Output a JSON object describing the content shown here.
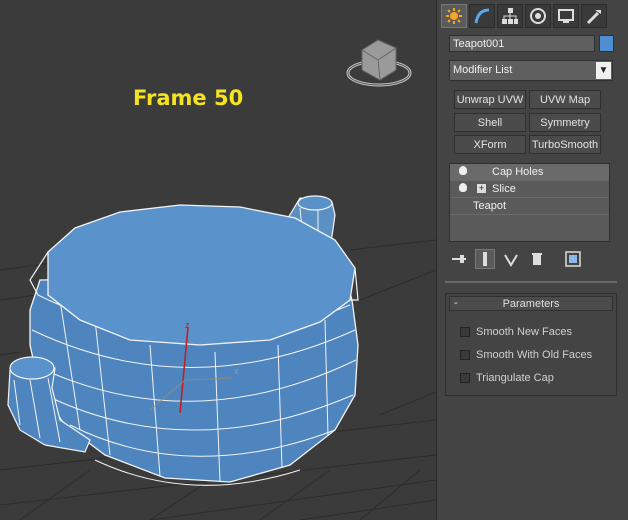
{
  "viewport": {
    "frame_label": "Frame 50"
  },
  "command_panel": {
    "tabs": [
      "create-icon",
      "modify-icon",
      "hierarchy-icon",
      "motion-icon",
      "display-icon",
      "utilities-icon"
    ],
    "object_name": "Teapot001",
    "object_color": "#4d8fd0",
    "modifier_list": "Modifier List",
    "modifier_buttons": [
      "Unwrap UVW",
      "UVW Map",
      "Shell",
      "Symmetry",
      "XForm",
      "TurboSmooth"
    ],
    "stack": [
      {
        "label": "Cap Holes"
      },
      {
        "label": "Slice"
      },
      {
        "label": "Teapot"
      }
    ],
    "stack_tools": [
      "pin-stack-icon",
      "show-end-result-icon",
      "make-unique-icon",
      "remove-modifier-icon",
      "configure-sets-icon"
    ]
  },
  "parameters": {
    "header": "Parameters",
    "collapse_symbol": "-",
    "options": [
      {
        "label": "Smooth New Faces",
        "checked": false
      },
      {
        "label": "Smooth With Old Faces",
        "checked": false
      },
      {
        "label": "Triangulate Cap",
        "checked": false
      }
    ]
  }
}
